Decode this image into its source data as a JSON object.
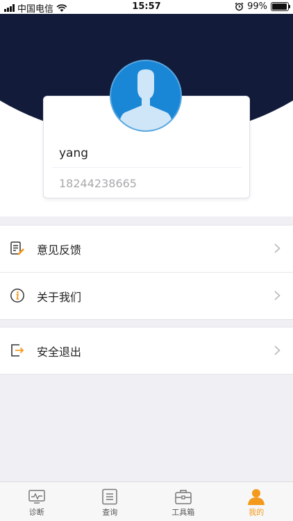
{
  "status_bar": {
    "carrier": "中国电信",
    "time": "15:57",
    "battery": "99%",
    "battery_level": 0.99
  },
  "profile": {
    "username": "yang",
    "phone": "18244238665"
  },
  "menu": {
    "group1": [
      {
        "label": "意见反馈",
        "icon": "feedback-icon"
      },
      {
        "label": "关于我们",
        "icon": "info-icon"
      }
    ],
    "group2": [
      {
        "label": "安全退出",
        "icon": "logout-icon"
      }
    ]
  },
  "tabs": [
    {
      "label": "诊断",
      "icon": "monitor-icon",
      "active": false
    },
    {
      "label": "查询",
      "icon": "list-icon",
      "active": false
    },
    {
      "label": "工具箱",
      "icon": "toolbox-icon",
      "active": false
    },
    {
      "label": "我的",
      "icon": "person-icon",
      "active": true
    }
  ],
  "colors": {
    "header": "#121b3a",
    "accent": "#f39a1c",
    "avatar": "#1a86d6"
  }
}
